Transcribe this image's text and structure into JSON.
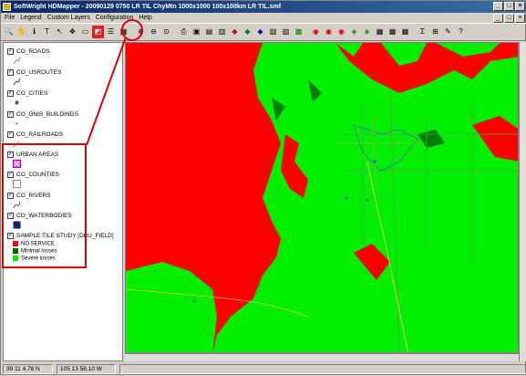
{
  "window": {
    "title": "SoftWright HDMapper - 20090129 0750 LR TIL ChyMtn 1000x1000 100x100km LR TIL.smf"
  },
  "menu": {
    "items": [
      "File",
      "Legend",
      "Custom Layers",
      "Configuration",
      "Help"
    ]
  },
  "toolbar": {
    "icons": [
      "zoom-icon",
      "pan-icon",
      "info-icon",
      "text-icon",
      "pointer-icon",
      "move-icon",
      "select-icon",
      "tile-study-icon",
      "layers-icon",
      "grid-icon",
      "zoom-in-icon",
      "zoom-out-icon",
      "zoom-full-icon",
      "print-icon",
      "save-icon",
      "open-icon",
      "export-icon",
      "ruler-icon",
      "profile-icon",
      "sum-icon",
      "edit-icon",
      "help-icon"
    ]
  },
  "layers": [
    {
      "name": "CO_ROADS",
      "checked": true
    },
    {
      "name": "CO_USROUTES",
      "checked": true
    },
    {
      "name": "CO_CITIES",
      "checked": true
    },
    {
      "name": "CO_GNIS_BUILDINGS",
      "checked": true
    },
    {
      "name": "CO_RAILROADS",
      "checked": true
    },
    {
      "name": "URBAN AREAS",
      "checked": true
    },
    {
      "name": "CO_COUNTIES",
      "checked": true
    },
    {
      "name": "CO_RIVERS",
      "checked": true
    },
    {
      "name": "CO_WATERBODIES",
      "checked": true
    },
    {
      "name": "SAMPLE TILE STUDY [DBU_FIELD]",
      "checked": true
    }
  ],
  "legend": [
    {
      "label": "NO SERVICE",
      "color": "#ff0000"
    },
    {
      "label": "Minimal losses",
      "color": "#006400"
    },
    {
      "label": "Severe losses",
      "color": "#00ee00"
    }
  ],
  "status": {
    "latitude": "39 11 4.78 N",
    "longitude": "105 13 56.10 W"
  },
  "colors": {
    "no_service": "#ff0000",
    "severe": "#00ee00",
    "minimal": "#008000",
    "callout": "#e00000"
  }
}
